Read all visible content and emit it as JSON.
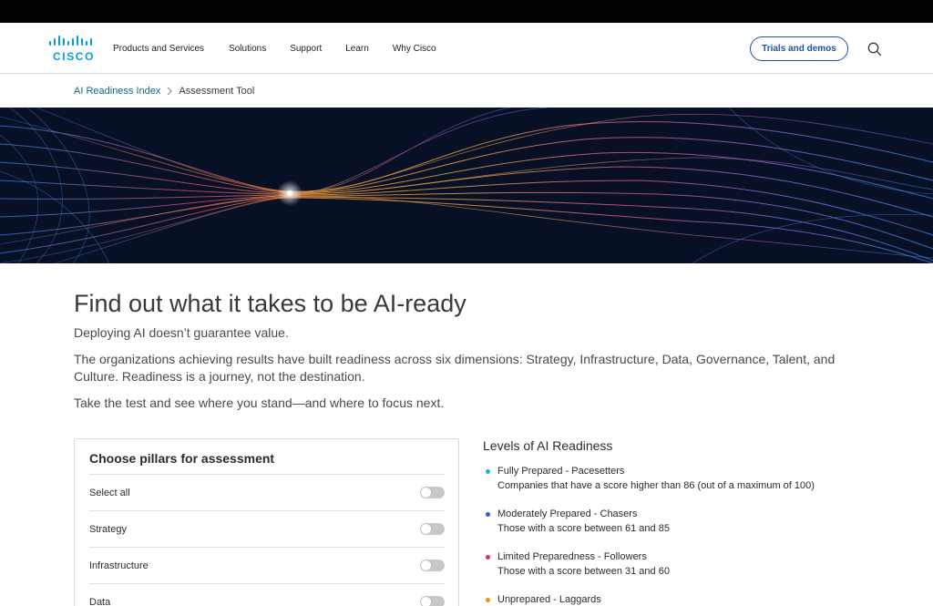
{
  "brand": {
    "logo_text": "CISCO",
    "logo_color": "#049fd9"
  },
  "nav": {
    "items": [
      {
        "label": "Products and Services"
      },
      {
        "label": "Solutions"
      },
      {
        "label": "Support"
      },
      {
        "label": "Learn"
      },
      {
        "label": "Why Cisco"
      }
    ],
    "trials_label": "Trials and demos",
    "search_icon": "search-icon"
  },
  "breadcrumb": {
    "parent": "AI Readiness Index",
    "current": "Assessment Tool"
  },
  "intro": {
    "title": "Find out what it takes to be AI-ready",
    "p1": "Deploying AI doesn’t guarantee value.",
    "p2": "The organizations achieving results have built readiness across six dimensions: Strategy, Infrastructure, Data, Governance, Talent, and Culture. Readiness is a journey, not the destination.",
    "p3": "Take the test and see where you stand—and where to focus next."
  },
  "pillars": {
    "title": "Choose pillars for assessment",
    "rows": [
      {
        "label": "Select all",
        "on": false
      },
      {
        "label": "Strategy",
        "on": false
      },
      {
        "label": "Infrastructure",
        "on": false
      },
      {
        "label": "Data",
        "on": false
      }
    ]
  },
  "levels": {
    "title": "Levels of AI Readiness",
    "items": [
      {
        "name": "Fully Prepared - Pacesetters",
        "desc": "Companies that have a score higher than 86 (out of a maximum of 100)",
        "color": "#1bb7c8"
      },
      {
        "name": "Moderately Prepared - Chasers",
        "desc": "Those with a score between 61 and 85",
        "color": "#2a5bd7"
      },
      {
        "name": "Limited Preparedness - Followers",
        "desc": "Those with a score between 31 and 60",
        "color": "#e0267a"
      },
      {
        "name": "Unprepared - Laggards",
        "desc": "",
        "color": "#f0931d"
      }
    ]
  }
}
